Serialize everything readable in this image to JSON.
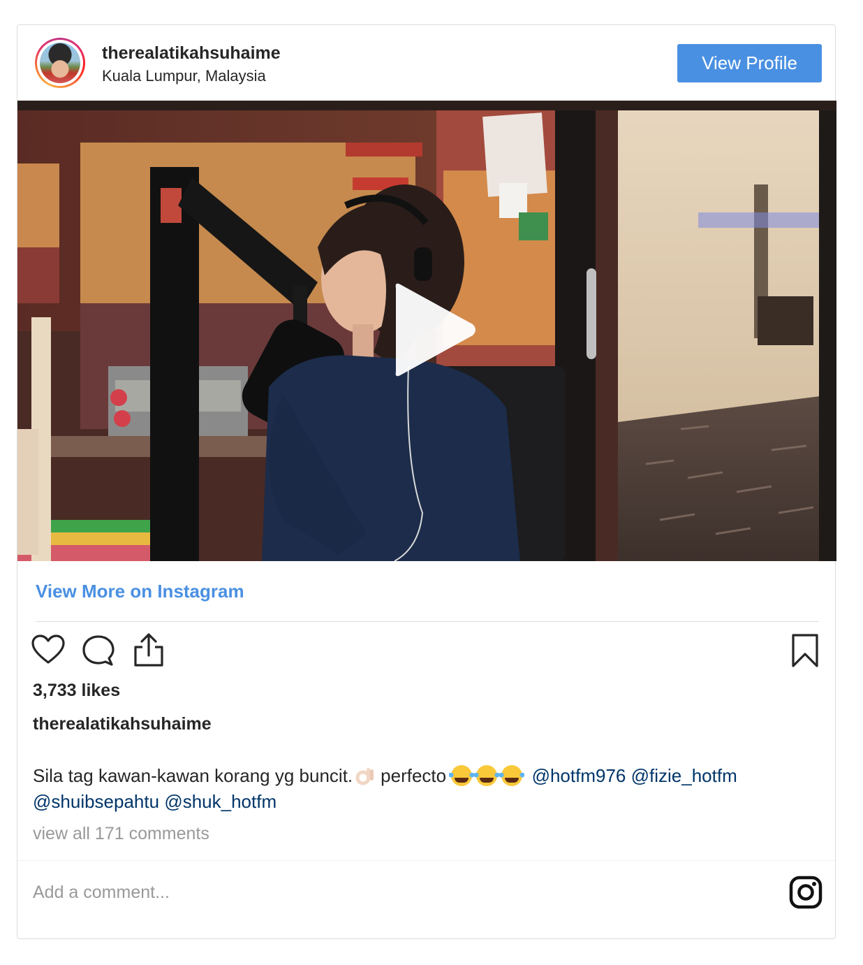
{
  "header": {
    "username": "therealatikahsuhaime",
    "location": "Kuala Lumpur, Malaysia",
    "view_profile_label": "View Profile"
  },
  "media": {
    "type": "video",
    "play_icon": "play-icon"
  },
  "view_more_label": "View More on Instagram",
  "actions": {
    "like_icon": "heart-icon",
    "comment_icon": "comment-icon",
    "share_icon": "share-icon",
    "save_icon": "bookmark-icon"
  },
  "likes": "3,733 likes",
  "caption": {
    "username": "therealatikahsuhaime",
    "text_part1": "Sila tag kawan-kawan korang yg buncit.",
    "text_part2": "perfecto",
    "mentions": [
      "@hotfm976",
      "@fizie_hotfm",
      "@shuibsepahtu",
      "@shuk_hotfm"
    ]
  },
  "view_all_comments": "view all 171 comments",
  "comment_input": {
    "placeholder": "Add a comment..."
  },
  "footer_icon": "instagram-icon",
  "colors": {
    "accent_blue": "#4a90e2",
    "mention_blue": "#003569",
    "muted_gray": "#999999",
    "border": "#dbdbdb"
  }
}
